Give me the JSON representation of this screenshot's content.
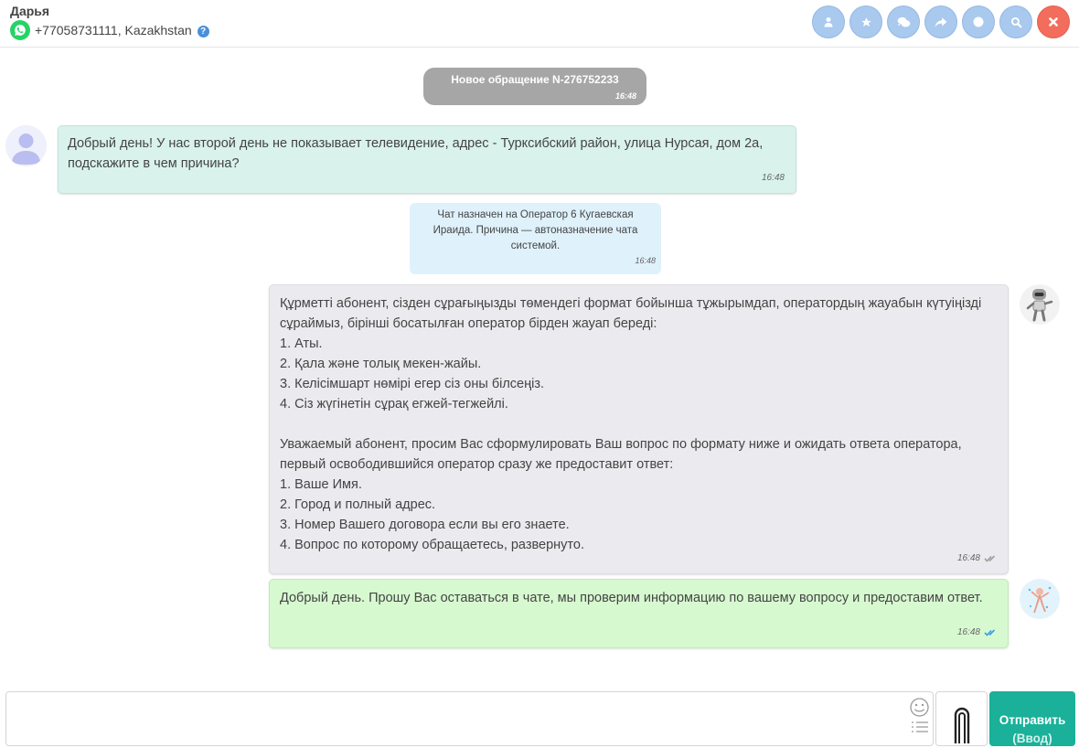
{
  "header": {
    "contact_name": "Дарья",
    "phone": "+77058731111, Kazakhstan",
    "help": "?",
    "icons": [
      "user-icon",
      "star-icon",
      "comments-icon",
      "share-icon",
      "circle-icon",
      "search-icon",
      "close-icon"
    ]
  },
  "messages": {
    "new_ticket": {
      "text": "Новое обращение N-276752233",
      "time": "16:48"
    },
    "client": {
      "text": "Добрый день! У нас второй день не показывает телевидение, адрес - Турксибский район, улица Нурсая, дом 2а, подскажите в чем причина?",
      "time": "16:48"
    },
    "assigned": {
      "text": "Чат назначен на Оператор 6 Кугаевская Ираида. Причина — автоназначение чата системой.",
      "time": "16:48"
    },
    "bot": {
      "text": "Құрметті абонент, сізден сұрағыңызды төмендегі формат бойынша тұжырымдап, оператордың жауабын күтуіңізді сұраймыз, бірінші босатылған оператор бірден жауап береді:\n1. Аты.\n2. Қала және толық мекен-жайы.\n3. Келісімшарт нөмірі егер сіз оны білсеңіз.\n4. Сіз жүгінетін сұрақ егжей-тегжейлі.\n\nУважаемый абонент, просим Вас сформулировать Ваш вопрос по формату ниже и ожидать ответа оператора, первый освободившийся оператор сразу же предоставит ответ:\n1. Ваше Имя.\n2. Город и полный адрес.\n3. Номер Вашего договора если вы его знаете.\n4. Вопрос по которому обращаетесь, развернуто.",
      "time": "16:48",
      "status_color": "#9e9e9e"
    },
    "operator": {
      "text": "Добрый день. Прошу Вас оставаться в чате, мы проверим информацию по вашему вопросу и предоставим ответ.",
      "time": "16:48",
      "status_color": "#3b9be8"
    }
  },
  "composer": {
    "placeholder": "",
    "send_label": "Отправить",
    "send_hint": "(Ввод)"
  },
  "colors": {
    "accent": "#1ab09a",
    "toolbar_button": "#a9c9ee",
    "close_button": "#f26d5b",
    "client_bubble": "#d9f2ec",
    "bot_bubble": "#ebebef",
    "operator_bubble": "#d7f9d0"
  }
}
